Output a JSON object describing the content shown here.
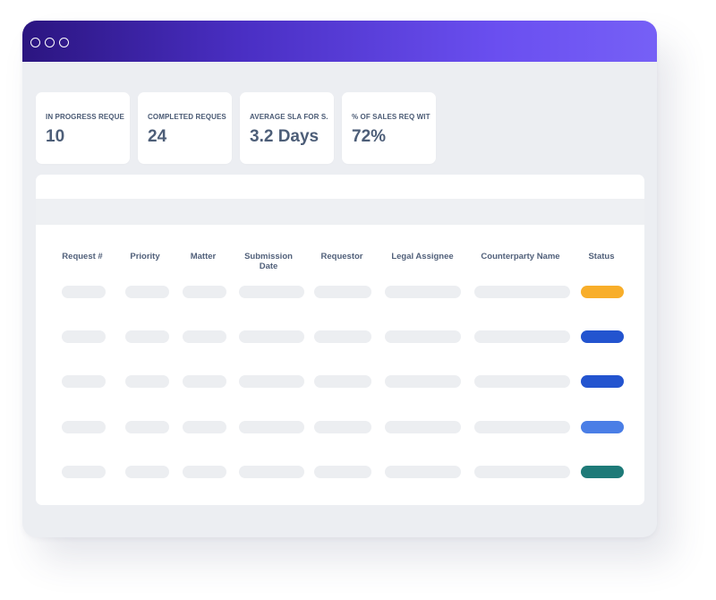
{
  "window": {
    "controls": [
      "window-dot-1",
      "window-dot-2",
      "window-dot-3"
    ]
  },
  "stats": [
    {
      "label": "IN PROGRESS REQUE",
      "value": "10"
    },
    {
      "label": "COMPLETED REQUES",
      "value": "24"
    },
    {
      "label": "AVERAGE SLA FOR S.",
      "value": "3.2 Days"
    },
    {
      "label": "% OF SALES REQ WIT",
      "value": "72%"
    }
  ],
  "table": {
    "columns": [
      "Request #",
      "Priority",
      "Matter",
      "Submission Date",
      "Requestor",
      "Legal Assignee",
      "Counterparty Name",
      "Status"
    ],
    "row_count": 5,
    "statuses": [
      {
        "color": "#f8ae2a"
      },
      {
        "color": "#2354cf"
      },
      {
        "color": "#2354cf"
      },
      {
        "color": "#4a7ee6"
      },
      {
        "color": "#1e7a78"
      }
    ]
  },
  "colors": {
    "titlebar_start": "#2b1580",
    "titlebar_end": "#7660f6",
    "background": "#eceef2",
    "placeholder": "#eceef1"
  }
}
